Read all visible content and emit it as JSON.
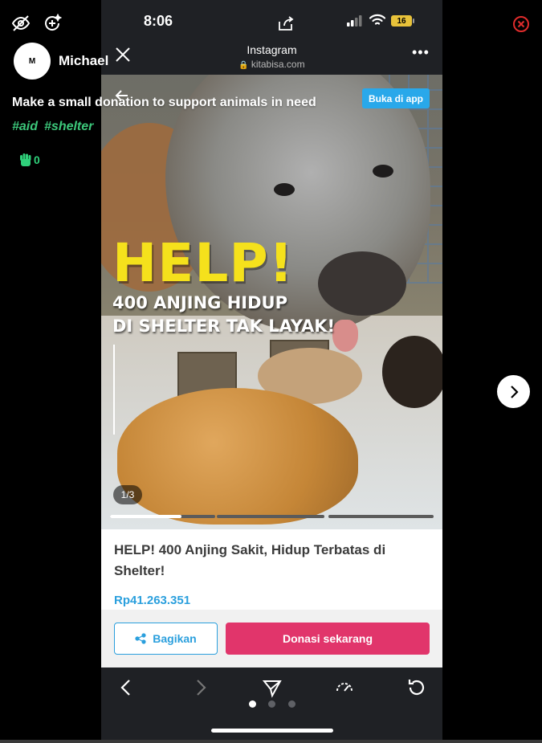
{
  "overlay": {
    "user": {
      "avatar_initial": "M",
      "name": "Michael"
    },
    "caption": "Make a small donation to support animals in need",
    "hashtags": [
      "#aid",
      "#shelter"
    ],
    "like_count": "0",
    "icons": {
      "hide": "eye-off-icon",
      "add": "add-sparkle-icon",
      "close": "close-circle-icon",
      "next": "chevron-right-icon"
    }
  },
  "phone": {
    "status": {
      "time": "8:06",
      "battery": "16"
    },
    "browser_header": {
      "title": "Instagram",
      "url": "kitabisa.com"
    },
    "hero": {
      "open_app_label": "Buka di app",
      "headline": "HELP!",
      "subline_1": "400 ANJING HIDUP",
      "subline_2": "DI SHELTER TAK LAYAK!",
      "page_indicator": "1/3",
      "current_slide": 1,
      "slide_count": 3,
      "slide_progress": 0.68
    },
    "campaign": {
      "title": "HELP! 400 Anjing Sakit, Hidup Terbatas di Shelter!",
      "amount": "Rp41.263.351",
      "share_label": "Bagikan",
      "donate_label": "Donasi sekarang"
    },
    "bottom_nav": {
      "active_page_dot": 0,
      "page_dots": 3
    },
    "colors": {
      "accent_blue": "#2a9fdd",
      "donate_pink": "#e1356b",
      "headline_yellow": "#f5e11c",
      "hashtag_green": "#3cc77a"
    }
  }
}
